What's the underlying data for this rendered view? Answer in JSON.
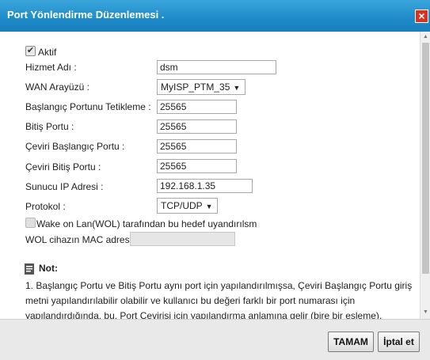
{
  "dialog": {
    "title": "Port Yönlendirme Düzenlemesi ."
  },
  "form": {
    "active_label": "Aktif",
    "active_checked": true,
    "service_name_label": "Hizmet Adı :",
    "service_name_value": "dsm",
    "wan_interface_label": "WAN Arayüzü :",
    "wan_interface_value": "MyISP_PTM_35",
    "start_port_label": "Başlangıç Portunu Tetikleme :",
    "start_port_value": "25565",
    "end_port_label": "Bitiş Portu :",
    "end_port_value": "25565",
    "trans_start_label": "Çeviri Başlangıç Portu :",
    "trans_start_value": "25565",
    "trans_end_label": "Çeviri Bitiş Portu :",
    "trans_end_value": "25565",
    "server_ip_label": "Sunucu IP Adresi :",
    "server_ip_value": "192.168.1.35",
    "protocol_label": "Protokol :",
    "protocol_value": "TCP/UDP",
    "wol_label": "Wake on Lan(WOL) tarafından bu hedef uyandırılsm",
    "wol_checked": false,
    "wol_mac_label": "WOL cihazın MAC adresi",
    "wol_mac_value": ""
  },
  "note": {
    "title": "Not:",
    "text": "1.   Başlangıç Portu ve Bitiş Portu aynı port için yapılandırılmışsa, Çeviri Başlangıç Portu giriş metni yapılandırılabilir olabilir ve kullanıcı bu değeri farklı bir port numarası için yapılandırdığında, bu, Port Çevirisi için yapılandırma anlamına gelir (bire bir eşleme)."
  },
  "footer": {
    "ok_label": "TAMAM",
    "cancel_label": "İptal et"
  },
  "colors": {
    "titlebar": "#1e8bc8",
    "close": "#d9331f"
  }
}
